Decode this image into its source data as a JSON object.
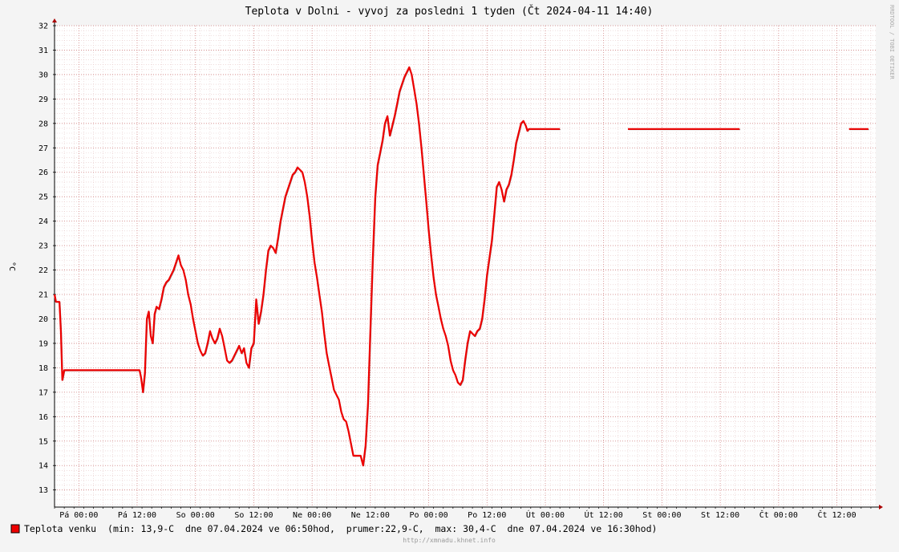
{
  "chart_data": {
    "type": "line",
    "title": "Teplota v Dolni - vyvoj za posledni 1 tyden (Čt 2024-04-11 14:40)",
    "ylabel": "°C",
    "xlabel": "",
    "ylim": [
      12.3,
      32
    ],
    "yticks": [
      13,
      14,
      15,
      16,
      17,
      18,
      19,
      20,
      21,
      22,
      23,
      24,
      25,
      26,
      27,
      28,
      29,
      30,
      31,
      32
    ],
    "xlim": [
      0,
      169
    ],
    "x_ticks": [
      {
        "x": 5,
        "label": "Pá 00:00"
      },
      {
        "x": 17,
        "label": "Pá 12:00"
      },
      {
        "x": 29,
        "label": "So 00:00"
      },
      {
        "x": 41,
        "label": "So 12:00"
      },
      {
        "x": 53,
        "label": "Ne 00:00"
      },
      {
        "x": 65,
        "label": "Ne 12:00"
      },
      {
        "x": 77,
        "label": "Po 00:00"
      },
      {
        "x": 89,
        "label": "Po 12:00"
      },
      {
        "x": 101,
        "label": "Út 00:00"
      },
      {
        "x": 113,
        "label": "Út 12:00"
      },
      {
        "x": 125,
        "label": "St 00:00"
      },
      {
        "x": 137,
        "label": "St 12:00"
      },
      {
        "x": 149,
        "label": "Čt 00:00"
      },
      {
        "x": 161,
        "label": "Čt 12:00"
      }
    ],
    "grid": true,
    "series": [
      {
        "name": "Teplota venku",
        "color": "#ee0000",
        "segments": [
          [
            [
              0,
              21.0
            ],
            [
              0.3,
              20.7
            ],
            [
              1,
              20.7
            ],
            [
              1.3,
              19.5
            ],
            [
              1.6,
              17.5
            ],
            [
              2,
              17.9
            ],
            [
              4,
              17.9
            ],
            [
              10,
              17.9
            ],
            [
              17.5,
              17.9
            ],
            [
              17.8,
              17.6
            ],
            [
              18.2,
              17.0
            ],
            [
              18.6,
              17.8
            ],
            [
              19.0,
              20.0
            ],
            [
              19.4,
              20.3
            ],
            [
              19.8,
              19.3
            ],
            [
              20.2,
              19.0
            ],
            [
              20.6,
              20.2
            ],
            [
              21.0,
              20.5
            ],
            [
              21.5,
              20.4
            ],
            [
              22.0,
              20.8
            ],
            [
              22.5,
              21.3
            ],
            [
              23.0,
              21.5
            ],
            [
              23.5,
              21.6
            ],
            [
              24.0,
              21.8
            ],
            [
              24.5,
              22.0
            ],
            [
              25.0,
              22.3
            ],
            [
              25.5,
              22.6
            ],
            [
              26.0,
              22.2
            ],
            [
              26.5,
              22.0
            ],
            [
              27.0,
              21.6
            ],
            [
              27.5,
              21.0
            ],
            [
              28.0,
              20.6
            ],
            [
              28.5,
              20.0
            ],
            [
              29.0,
              19.5
            ],
            [
              29.5,
              19.0
            ],
            [
              30.0,
              18.7
            ],
            [
              30.5,
              18.5
            ],
            [
              31.0,
              18.6
            ],
            [
              31.5,
              19.0
            ],
            [
              32.0,
              19.5
            ],
            [
              32.5,
              19.2
            ],
            [
              33.0,
              19.0
            ],
            [
              33.5,
              19.2
            ],
            [
              34.0,
              19.6
            ],
            [
              34.5,
              19.3
            ],
            [
              35.0,
              18.8
            ],
            [
              35.5,
              18.3
            ],
            [
              36.0,
              18.2
            ],
            [
              36.5,
              18.3
            ],
            [
              37.0,
              18.5
            ],
            [
              37.5,
              18.7
            ],
            [
              38.0,
              18.9
            ],
            [
              38.5,
              18.6
            ],
            [
              39.0,
              18.8
            ],
            [
              39.5,
              18.2
            ],
            [
              40.0,
              18.0
            ],
            [
              40.5,
              18.8
            ],
            [
              41.0,
              19.0
            ],
            [
              41.5,
              20.8
            ],
            [
              42.0,
              19.8
            ],
            [
              42.5,
              20.3
            ],
            [
              43.0,
              21.0
            ],
            [
              43.5,
              22.0
            ],
            [
              44.0,
              22.8
            ],
            [
              44.5,
              23.0
            ],
            [
              45.0,
              22.9
            ],
            [
              45.5,
              22.7
            ],
            [
              46.0,
              23.3
            ],
            [
              46.5,
              24.0
            ],
            [
              47.0,
              24.5
            ],
            [
              47.5,
              25.0
            ],
            [
              48.0,
              25.3
            ],
            [
              48.5,
              25.6
            ],
            [
              49.0,
              25.9
            ],
            [
              49.5,
              26.0
            ],
            [
              50.0,
              26.2
            ],
            [
              50.5,
              26.1
            ],
            [
              51.0,
              26.0
            ],
            [
              51.5,
              25.6
            ],
            [
              52.0,
              25.0
            ],
            [
              52.5,
              24.2
            ],
            [
              53.0,
              23.2
            ],
            [
              53.5,
              22.3
            ],
            [
              54.0,
              21.7
            ],
            [
              54.5,
              21.0
            ],
            [
              55.0,
              20.3
            ],
            [
              55.5,
              19.4
            ],
            [
              56.0,
              18.6
            ],
            [
              56.5,
              18.1
            ],
            [
              57.0,
              17.6
            ],
            [
              57.5,
              17.1
            ],
            [
              58.0,
              16.9
            ],
            [
              58.5,
              16.7
            ],
            [
              59.0,
              16.2
            ],
            [
              59.5,
              15.9
            ],
            [
              60.0,
              15.8
            ],
            [
              60.5,
              15.4
            ],
            [
              61.0,
              14.9
            ],
            [
              61.5,
              14.4
            ],
            [
              62.0,
              14.4
            ],
            [
              62.5,
              14.4
            ],
            [
              63.0,
              14.4
            ],
            [
              63.5,
              14.0
            ],
            [
              64.0,
              14.8
            ],
            [
              64.5,
              16.5
            ],
            [
              65.0,
              19.5
            ],
            [
              65.5,
              22.5
            ],
            [
              66.0,
              25.0
            ],
            [
              66.5,
              26.3
            ],
            [
              67.0,
              26.8
            ],
            [
              67.5,
              27.3
            ],
            [
              68.0,
              28.0
            ],
            [
              68.5,
              28.3
            ],
            [
              69.0,
              27.5
            ],
            [
              69.5,
              27.9
            ],
            [
              70.0,
              28.3
            ],
            [
              70.5,
              28.8
            ],
            [
              71.0,
              29.3
            ],
            [
              71.5,
              29.6
            ],
            [
              72.0,
              29.9
            ],
            [
              72.5,
              30.1
            ],
            [
              73.0,
              30.3
            ],
            [
              73.5,
              30.0
            ],
            [
              74.0,
              29.4
            ],
            [
              74.5,
              28.8
            ],
            [
              75.0,
              28.0
            ],
            [
              75.5,
              27.0
            ],
            [
              76.0,
              25.9
            ],
            [
              76.5,
              24.8
            ],
            [
              77.0,
              23.6
            ],
            [
              77.5,
              22.6
            ],
            [
              78.0,
              21.7
            ],
            [
              78.5,
              21.0
            ],
            [
              79.0,
              20.5
            ],
            [
              79.5,
              20.0
            ],
            [
              80.0,
              19.6
            ],
            [
              80.5,
              19.3
            ],
            [
              81.0,
              18.9
            ],
            [
              81.5,
              18.3
            ],
            [
              82.0,
              17.9
            ],
            [
              82.5,
              17.7
            ],
            [
              83.0,
              17.4
            ],
            [
              83.5,
              17.3
            ],
            [
              84.0,
              17.5
            ],
            [
              84.5,
              18.3
            ],
            [
              85.0,
              19.0
            ],
            [
              85.5,
              19.5
            ],
            [
              86.0,
              19.4
            ],
            [
              86.5,
              19.3
            ],
            [
              87.0,
              19.5
            ],
            [
              87.5,
              19.6
            ],
            [
              88.0,
              20.0
            ],
            [
              88.5,
              20.8
            ],
            [
              89.0,
              21.8
            ],
            [
              89.5,
              22.5
            ],
            [
              90.0,
              23.2
            ],
            [
              90.5,
              24.3
            ],
            [
              91.0,
              25.4
            ],
            [
              91.5,
              25.6
            ],
            [
              92.0,
              25.3
            ],
            [
              92.5,
              24.8
            ],
            [
              93.0,
              25.3
            ],
            [
              93.5,
              25.5
            ],
            [
              94.0,
              25.9
            ],
            [
              94.5,
              26.5
            ],
            [
              95.0,
              27.2
            ],
            [
              95.5,
              27.6
            ],
            [
              96.0,
              28.0
            ],
            [
              96.5,
              28.1
            ],
            [
              97.0,
              27.9
            ],
            [
              97.3,
              27.7
            ],
            [
              97.6,
              27.77
            ],
            [
              104.0,
              27.77
            ]
          ],
          [
            [
              118.0,
              27.77
            ],
            [
              141.0,
              27.77
            ]
          ],
          [
            [
              163.5,
              27.77
            ],
            [
              167.5,
              27.77
            ]
          ]
        ]
      }
    ],
    "legend": {
      "label": "Teplota venku",
      "stats": "(min: 13,9-C  dne 07.04.2024 ve 06:50hod,  prumer:22,9-C,  max: 30,4-C  dne 07.04.2024 ve 16:30hod)"
    },
    "watermark": "RRDTOOL / TOBI OETIKER",
    "footer": "http://xmnadu.khnet.info"
  }
}
